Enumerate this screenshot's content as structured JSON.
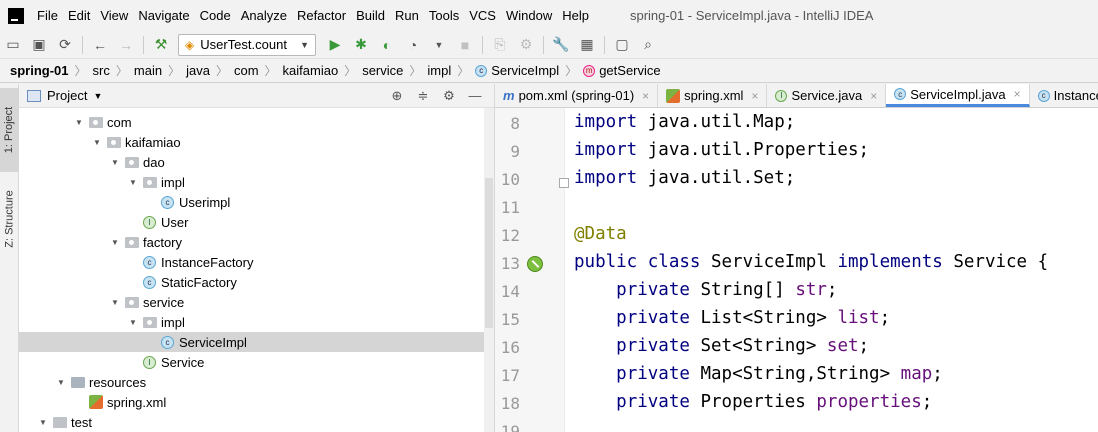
{
  "menubar": {
    "items": [
      "File",
      "Edit",
      "View",
      "Navigate",
      "Code",
      "Analyze",
      "Refactor",
      "Build",
      "Run",
      "Tools",
      "VCS",
      "Window",
      "Help"
    ],
    "window_title": "spring-01 - ServiceImpl.java - IntelliJ IDEA"
  },
  "toolbar": {
    "run_config": "UserTest.count"
  },
  "breadcrumbs": [
    {
      "label": "spring-01",
      "bold": true
    },
    {
      "label": "src"
    },
    {
      "label": "main"
    },
    {
      "label": "java"
    },
    {
      "label": "com"
    },
    {
      "label": "kaifamiao"
    },
    {
      "label": "service"
    },
    {
      "label": "impl"
    },
    {
      "label": "ServiceImpl",
      "badge": "c"
    },
    {
      "label": "getService",
      "badge": "m"
    }
  ],
  "tool_strip": {
    "project_tab": "1: Project",
    "structure_tab": "Z: Structure"
  },
  "project_panel": {
    "title": "Project",
    "tree": [
      {
        "label": "com",
        "depth": 4,
        "kind": "pkg",
        "expanded": true
      },
      {
        "label": "kaifamiao",
        "depth": 5,
        "kind": "pkg",
        "expanded": true
      },
      {
        "label": "dao",
        "depth": 6,
        "kind": "pkg",
        "expanded": true
      },
      {
        "label": "impl",
        "depth": 7,
        "kind": "pkg",
        "expanded": true
      },
      {
        "label": "Userimpl",
        "depth": 8,
        "kind": "class"
      },
      {
        "label": "User",
        "depth": 7,
        "kind": "iface"
      },
      {
        "label": "factory",
        "depth": 6,
        "kind": "pkg",
        "expanded": true
      },
      {
        "label": "InstanceFactory",
        "depth": 7,
        "kind": "class"
      },
      {
        "label": "StaticFactory",
        "depth": 7,
        "kind": "class"
      },
      {
        "label": "service",
        "depth": 6,
        "kind": "pkg",
        "expanded": true
      },
      {
        "label": "impl",
        "depth": 7,
        "kind": "pkg",
        "expanded": true
      },
      {
        "label": "ServiceImpl",
        "depth": 8,
        "kind": "class",
        "selected": true
      },
      {
        "label": "Service",
        "depth": 7,
        "kind": "iface"
      },
      {
        "label": "resources",
        "depth": 3,
        "kind": "res",
        "expanded": true
      },
      {
        "label": "spring.xml",
        "depth": 4,
        "kind": "xml"
      },
      {
        "label": "test",
        "depth": 2,
        "kind": "folder",
        "expanded": true
      }
    ]
  },
  "editor": {
    "tabs": [
      {
        "label": "pom.xml (spring-01)",
        "icon": "m"
      },
      {
        "label": "spring.xml",
        "icon": "xml"
      },
      {
        "label": "Service.java",
        "icon": "i"
      },
      {
        "label": "ServiceImpl.java",
        "icon": "c",
        "active": true
      },
      {
        "label": "Instance",
        "icon": "c"
      }
    ],
    "lines": [
      {
        "n": "8",
        "tokens": [
          [
            "kw",
            "import"
          ],
          [
            "",
            "java.util.Map;"
          ]
        ]
      },
      {
        "n": "9",
        "tokens": [
          [
            "kw",
            "import"
          ],
          [
            "",
            "java.util.Properties;"
          ]
        ]
      },
      {
        "n": "10",
        "tokens": [
          [
            "kw",
            "import"
          ],
          [
            "",
            "java.util.Set;"
          ]
        ]
      },
      {
        "n": "11",
        "tokens": []
      },
      {
        "n": "12",
        "tokens": [
          [
            "anno",
            "@Data"
          ]
        ]
      },
      {
        "n": "13",
        "tokens": [
          [
            "kw",
            "public class"
          ],
          [
            "",
            "ServiceImpl"
          ],
          [
            "kw",
            "implements"
          ],
          [
            "",
            "Service {"
          ]
        ]
      },
      {
        "n": "14",
        "tokens": [
          [
            "",
            "  "
          ],
          [
            "kw",
            "private"
          ],
          [
            "",
            "String[]"
          ],
          [
            "fld",
            "str"
          ],
          [
            "",
            ";"
          ]
        ]
      },
      {
        "n": "15",
        "tokens": [
          [
            "",
            "  "
          ],
          [
            "kw",
            "private"
          ],
          [
            "",
            "List<String>"
          ],
          [
            "fld",
            "list"
          ],
          [
            "",
            ";"
          ]
        ]
      },
      {
        "n": "16",
        "tokens": [
          [
            "",
            "  "
          ],
          [
            "kw",
            "private"
          ],
          [
            "",
            "Set<String>"
          ],
          [
            "fld",
            "set"
          ],
          [
            "",
            ";"
          ]
        ]
      },
      {
        "n": "17",
        "tokens": [
          [
            "",
            "  "
          ],
          [
            "kw",
            "private"
          ],
          [
            "",
            "Map<String,String>"
          ],
          [
            "fld",
            "map"
          ],
          [
            "",
            ";"
          ]
        ]
      },
      {
        "n": "18",
        "tokens": [
          [
            "",
            "  "
          ],
          [
            "kw",
            "private"
          ],
          [
            "",
            "Properties"
          ],
          [
            "fld",
            "properties"
          ],
          [
            "",
            ";"
          ]
        ]
      },
      {
        "n": "19",
        "tokens": []
      }
    ]
  }
}
